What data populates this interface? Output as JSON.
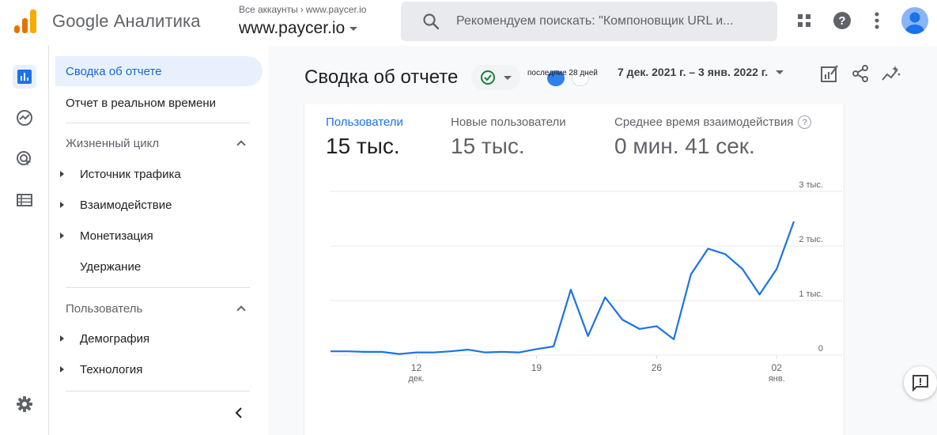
{
  "app": {
    "product_name": "Google Аналитика",
    "account_crumb": [
      "Все аккаунты",
      "www.paycer.io"
    ],
    "property": "www.paycer.io",
    "search_placeholder": "Рекомендуем поискать: \"Компоновщик URL и..."
  },
  "topbar_icons": [
    "apps-grid-icon",
    "help-icon",
    "more-vert-icon",
    "account-avatar"
  ],
  "rail": [
    "reports-icon",
    "explore-icon",
    "advertising-icon",
    "configure-icon",
    "settings-icon"
  ],
  "sidenav": {
    "overview": "Сводка об отчете",
    "realtime": "Отчет в реальном времени",
    "lifecycle": {
      "title": "Жизненный цикл",
      "items": [
        "Источник трафика",
        "Взаимодействие",
        "Монетизация",
        "Удержание"
      ]
    },
    "user": {
      "title": "Пользователь",
      "items": [
        "Демография",
        "Технология"
      ]
    }
  },
  "report": {
    "title": "Сводка об отчете",
    "range_label": "последние 28 дней",
    "date_range": "7 дек. 2021 г. – 3 янв. 2022 г."
  },
  "metrics": [
    {
      "label": "Пользователи",
      "value": "15 тыс."
    },
    {
      "label": "Новые пользователи",
      "value": "15 тыс."
    },
    {
      "label": "Среднее время взаимодействия",
      "value": "0 мин. 41 сек."
    }
  ],
  "colors": {
    "accent": "#1a73e8",
    "line": "#1a73e8",
    "active_nav_bg": "#e8f0fe",
    "search_bg": "#e8eaed"
  },
  "chart_data": {
    "type": "line",
    "x": [
      "2021-12-07",
      "2021-12-08",
      "2021-12-09",
      "2021-12-10",
      "2021-12-11",
      "2021-12-12",
      "2021-12-13",
      "2021-12-14",
      "2021-12-15",
      "2021-12-16",
      "2021-12-17",
      "2021-12-18",
      "2021-12-19",
      "2021-12-20",
      "2021-12-21",
      "2021-12-22",
      "2021-12-23",
      "2021-12-24",
      "2021-12-25",
      "2021-12-26",
      "2021-12-27",
      "2021-12-28",
      "2021-12-29",
      "2021-12-30",
      "2021-12-31",
      "2022-01-01",
      "2022-01-02",
      "2022-01-03"
    ],
    "x_ticks": [
      {
        "date": "2021-12-12",
        "label": "12",
        "sublabel": "дек."
      },
      {
        "date": "2021-12-19",
        "label": "19",
        "sublabel": ""
      },
      {
        "date": "2021-12-26",
        "label": "26",
        "sublabel": ""
      },
      {
        "date": "2022-01-02",
        "label": "02",
        "sublabel": "янв."
      }
    ],
    "series": [
      {
        "values": [
          70,
          70,
          60,
          60,
          20,
          50,
          50,
          70,
          100,
          50,
          60,
          50,
          110,
          160,
          1200,
          350,
          1060,
          650,
          480,
          530,
          290,
          1480,
          1950,
          1850,
          1580,
          1110,
          1580,
          2450
        ]
      }
    ],
    "y_ticks": [
      {
        "value": 0,
        "label": "0"
      },
      {
        "value": 1000,
        "label": "1 тыс."
      },
      {
        "value": 2000,
        "label": "2 тыс."
      },
      {
        "value": 3000,
        "label": "3 тыс."
      }
    ],
    "ylim": [
      0,
      3000
    ],
    "grid": true
  }
}
